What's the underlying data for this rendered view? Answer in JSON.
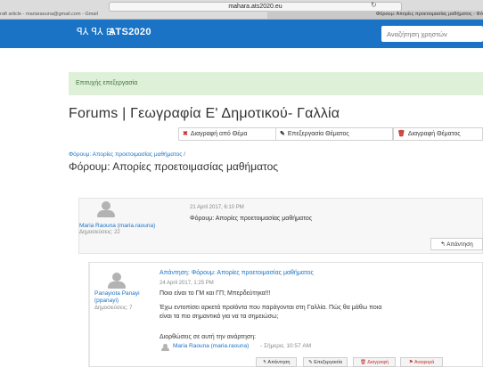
{
  "browser": {
    "url": "mahara.ats2020.eu",
    "reload_icon": "↻",
    "tab_left": "raft article - mariaraouna@gmail.com - Gmail",
    "tab_right": "Φόρουμ: Απορίες προετοιμασίας μαθήματος - Φό"
  },
  "navbar": {
    "logo_glyphs": "ꟼ⅄ ꟼ⅄ ⊟",
    "site_name": "ATS2020",
    "search_placeholder": "Αναζήτηση χρηστών"
  },
  "alert": {
    "text": "Επιτυχής επεξεργασία"
  },
  "page_title": "Forums | Γεωγραφία Ε' Δημοτικού- Γαλλία",
  "toolbar": {
    "delete_from_topic": {
      "icon": "✖",
      "label": "Διαγραφή από Θέμα"
    },
    "edit_topic": {
      "icon": "✎",
      "label": "Επεξεργασία Θέματος"
    },
    "delete_topic": {
      "icon": "🗑",
      "label": "Διαγραφή Θέματος"
    }
  },
  "breadcrumb": "Φόρουμ: Απορίες προετοιμασίας μαθήματος /",
  "forum_title": "Φόρουμ: Απορίες προετοιμασίας μαθήματος",
  "posts": [
    {
      "author": "Maria Raouna (maria.raouna)",
      "post_count": "Δημοσιεύσεις: 22",
      "date": "21 April 2017, 6:10 PM",
      "subject": "Φόρουμ: Απορίες προετοιμασίας μαθήματος",
      "reply_label": "Απάντηση",
      "reply_icon": "↰"
    },
    {
      "author_line1": "Panayiota Panayi",
      "author_line2": "(ppanayi)",
      "post_count": "Δημοσιεύσεις: 7",
      "subject": "Απάντηση: Φόρουμ: Απορίες προετοιμασίας μαθήματος",
      "date": "24 April 2017, 1:25 PM",
      "line1": "Ποιο είναι το ΓΜ και ΓΠ; Μπερδεύτηκα!!!",
      "line2": "Έχω εντοπίσει αρκετά προϊόντα που παράγονται στη Γαλλία. Πώς θα μάθω ποια",
      "line3": "είναι τα πιο σημαντικά για να τα σημειώσω;",
      "edits_label": "Διορθώσεις σε αυτή την ανάρτηση:",
      "edit_author": "Maria Raouna (maria.raouna)",
      "edit_time": " - Σήμερα, 10:57 AM",
      "actions": {
        "reply": "↰ Απάντηση",
        "edit": "✎ Επεξεργασία",
        "delete": "🗑 Διαγραφή",
        "report": "⚑ Αναφορά"
      }
    }
  ],
  "colors": {
    "brand": "#1a73c5",
    "danger": "#c9302c",
    "success_bg": "#dff0d8",
    "success_text": "#3c763d"
  }
}
